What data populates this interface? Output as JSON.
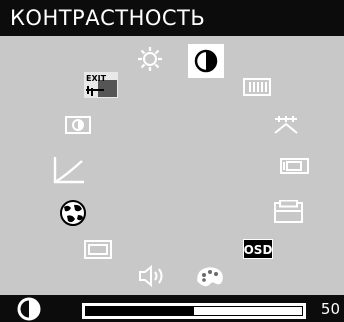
{
  "menu": {
    "title": "КОНТРАСТНОСТЬ",
    "selected_item": "contrast",
    "exit_label": "EXIT",
    "osd_label": "OSD"
  },
  "slider": {
    "value": "50",
    "fraction": 0.5
  },
  "colors": {
    "background": "#c8c8c8",
    "bar": "#0c0c0c",
    "selected": "#ffffff",
    "icon": "#ffffff"
  },
  "icons": [
    "exit-icon",
    "brightness-sun-icon",
    "contrast-icon",
    "h-size-icon",
    "contrast-small-icon",
    "degauss-icon",
    "gamma-icon",
    "h-position-icon",
    "language-globe-icon",
    "v-position-icon",
    "zoom-icon",
    "osd-icon",
    "volume-icon",
    "color-palette-icon"
  ]
}
